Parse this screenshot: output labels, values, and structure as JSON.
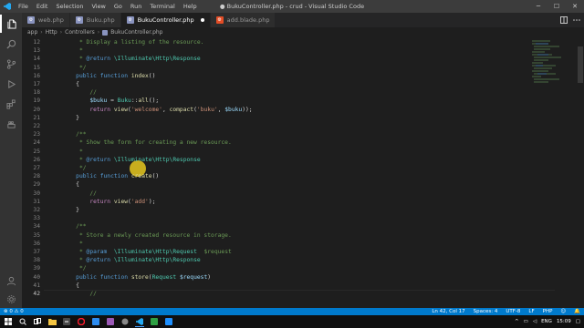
{
  "window": {
    "title": "● BukuController.php - crud - Visual Studio Code",
    "menu": [
      "File",
      "Edit",
      "Selection",
      "View",
      "Go",
      "Run",
      "Terminal",
      "Help"
    ]
  },
  "tabs": [
    {
      "label": "web.php",
      "icon": "php-file-icon",
      "active": false,
      "modified": false
    },
    {
      "label": "Buku.php",
      "icon": "php-file-icon",
      "active": false,
      "modified": false
    },
    {
      "label": "BukuController.php",
      "icon": "php-file-icon",
      "active": true,
      "modified": true
    },
    {
      "label": "add.blade.php",
      "icon": "blade-file-icon",
      "active": false,
      "modified": false
    }
  ],
  "breadcrumb": [
    "app",
    "Http",
    "Controllers",
    "BukuController.php"
  ],
  "editor": {
    "current_line": 42,
    "lines": [
      {
        "n": "12",
        "tokens": [
          {
            "t": "     * Display a listing of the resource.",
            "c": "cm"
          }
        ]
      },
      {
        "n": "13",
        "tokens": [
          {
            "t": "     *",
            "c": "cm"
          }
        ]
      },
      {
        "n": "14",
        "tokens": [
          {
            "t": "     * ",
            "c": "cm"
          },
          {
            "t": "@return",
            "c": "kwc"
          },
          {
            "t": " \\Illuminate\\Http\\Response",
            "c": "tyc"
          }
        ]
      },
      {
        "n": "15",
        "tokens": [
          {
            "t": "     */",
            "c": "cm"
          }
        ]
      },
      {
        "n": "16",
        "tokens": [
          {
            "t": "    public function ",
            "c": "kw"
          },
          {
            "t": "index",
            "c": "fn"
          },
          {
            "t": "()",
            "c": "pl"
          }
        ]
      },
      {
        "n": "17",
        "tokens": [
          {
            "t": "    {",
            "c": "pl"
          }
        ]
      },
      {
        "n": "18",
        "tokens": [
          {
            "t": "        //",
            "c": "cm"
          }
        ]
      },
      {
        "n": "19",
        "tokens": [
          {
            "t": "        ",
            "c": "pl"
          },
          {
            "t": "$buku",
            "c": "var"
          },
          {
            "t": " = ",
            "c": "pl"
          },
          {
            "t": "Buku",
            "c": "ty"
          },
          {
            "t": "::",
            "c": "pl"
          },
          {
            "t": "all",
            "c": "fn"
          },
          {
            "t": "();",
            "c": "pl"
          }
        ]
      },
      {
        "n": "20",
        "tokens": [
          {
            "t": "        return ",
            "c": "kw2"
          },
          {
            "t": "view",
            "c": "fn"
          },
          {
            "t": "(",
            "c": "pl"
          },
          {
            "t": "'welcome'",
            "c": "str"
          },
          {
            "t": ", ",
            "c": "pl"
          },
          {
            "t": "compact",
            "c": "fn"
          },
          {
            "t": "(",
            "c": "pl"
          },
          {
            "t": "'buku'",
            "c": "str"
          },
          {
            "t": ", ",
            "c": "pl"
          },
          {
            "t": "$buku",
            "c": "var"
          },
          {
            "t": "));",
            "c": "pl"
          }
        ]
      },
      {
        "n": "21",
        "tokens": [
          {
            "t": "    }",
            "c": "pl"
          }
        ]
      },
      {
        "n": "22",
        "tokens": [
          {
            "t": "",
            "c": "pl"
          }
        ]
      },
      {
        "n": "23",
        "tokens": [
          {
            "t": "    /**",
            "c": "cm"
          }
        ]
      },
      {
        "n": "24",
        "tokens": [
          {
            "t": "     * Show the form for creating a new resource.",
            "c": "cm"
          }
        ]
      },
      {
        "n": "25",
        "tokens": [
          {
            "t": "     *",
            "c": "cm"
          }
        ]
      },
      {
        "n": "26",
        "tokens": [
          {
            "t": "     * ",
            "c": "cm"
          },
          {
            "t": "@return",
            "c": "kwc"
          },
          {
            "t": " \\Illuminate\\Http\\Response",
            "c": "tyc"
          }
        ]
      },
      {
        "n": "27",
        "tokens": [
          {
            "t": "     */",
            "c": "cm"
          }
        ]
      },
      {
        "n": "28",
        "tokens": [
          {
            "t": "    public function ",
            "c": "kw"
          },
          {
            "t": "create",
            "c": "fn"
          },
          {
            "t": "()",
            "c": "pl"
          }
        ]
      },
      {
        "n": "29",
        "tokens": [
          {
            "t": "    {",
            "c": "pl"
          }
        ]
      },
      {
        "n": "30",
        "tokens": [
          {
            "t": "        //",
            "c": "cm"
          }
        ]
      },
      {
        "n": "31",
        "tokens": [
          {
            "t": "        return ",
            "c": "kw2"
          },
          {
            "t": "view",
            "c": "fn"
          },
          {
            "t": "(",
            "c": "pl"
          },
          {
            "t": "'add'",
            "c": "str"
          },
          {
            "t": ");",
            "c": "pl"
          }
        ]
      },
      {
        "n": "32",
        "tokens": [
          {
            "t": "    }",
            "c": "pl"
          }
        ]
      },
      {
        "n": "33",
        "tokens": [
          {
            "t": "",
            "c": "pl"
          }
        ]
      },
      {
        "n": "34",
        "tokens": [
          {
            "t": "    /**",
            "c": "cm"
          }
        ]
      },
      {
        "n": "35",
        "tokens": [
          {
            "t": "     * Store a newly created resource in storage.",
            "c": "cm"
          }
        ]
      },
      {
        "n": "36",
        "tokens": [
          {
            "t": "     *",
            "c": "cm"
          }
        ]
      },
      {
        "n": "37",
        "tokens": [
          {
            "t": "     * ",
            "c": "cm"
          },
          {
            "t": "@param",
            "c": "kwc"
          },
          {
            "t": "  \\Illuminate\\Http\\Request",
            "c": "tyc"
          },
          {
            "t": "  $request",
            "c": "cm"
          }
        ]
      },
      {
        "n": "38",
        "tokens": [
          {
            "t": "     * ",
            "c": "cm"
          },
          {
            "t": "@return",
            "c": "kwc"
          },
          {
            "t": " \\Illuminate\\Http\\Response",
            "c": "tyc"
          }
        ]
      },
      {
        "n": "39",
        "tokens": [
          {
            "t": "     */",
            "c": "cm"
          }
        ]
      },
      {
        "n": "40",
        "tokens": [
          {
            "t": "    public function ",
            "c": "kw"
          },
          {
            "t": "store",
            "c": "fn"
          },
          {
            "t": "(",
            "c": "pl"
          },
          {
            "t": "Request",
            "c": "ty"
          },
          {
            "t": " ",
            "c": "pl"
          },
          {
            "t": "$request",
            "c": "var"
          },
          {
            "t": ")",
            "c": "pl"
          }
        ]
      },
      {
        "n": "41",
        "tokens": [
          {
            "t": "    {",
            "c": "pl"
          }
        ]
      },
      {
        "n": "42",
        "tokens": [
          {
            "t": "        //",
            "c": "cm"
          }
        ]
      },
      {
        "n": "43",
        "tokens": [
          {
            "t": "        ",
            "c": "pl"
          },
          {
            "t": "$buku",
            "c": "var"
          },
          {
            "t": " =",
            "c": "pl"
          }
        ]
      },
      {
        "n": "44",
        "tokens": [
          {
            "t": "    }",
            "c": "pl"
          }
        ]
      }
    ]
  },
  "colors": {
    "cm": "#6a9955",
    "kw": "#569cd6",
    "kw2": "#c586c0",
    "fn": "#dcdcaa",
    "pl": "#d4d4d4",
    "var": "#9cdcfe",
    "ty": "#4ec9b0",
    "str": "#ce9178",
    "kwc": "#569cd6",
    "tyc": "#4ec9b0",
    "statusbar": "#007acc",
    "activity": "#333333"
  },
  "statusbar": {
    "left": [
      "⊗ 0  ⚠ 0"
    ],
    "right": [
      "Ln 42, Col 17",
      "Spaces: 4",
      "UTF-8",
      "LF",
      "PHP",
      "☺",
      "🔔"
    ]
  },
  "taskbar": {
    "time": "15:09",
    "lang": "ENG"
  },
  "activity_icons": [
    "files-icon",
    "search-icon",
    "source-control-icon",
    "run-debug-icon",
    "extensions-icon",
    "docker-icon",
    "account-icon",
    "settings-gear-icon"
  ]
}
